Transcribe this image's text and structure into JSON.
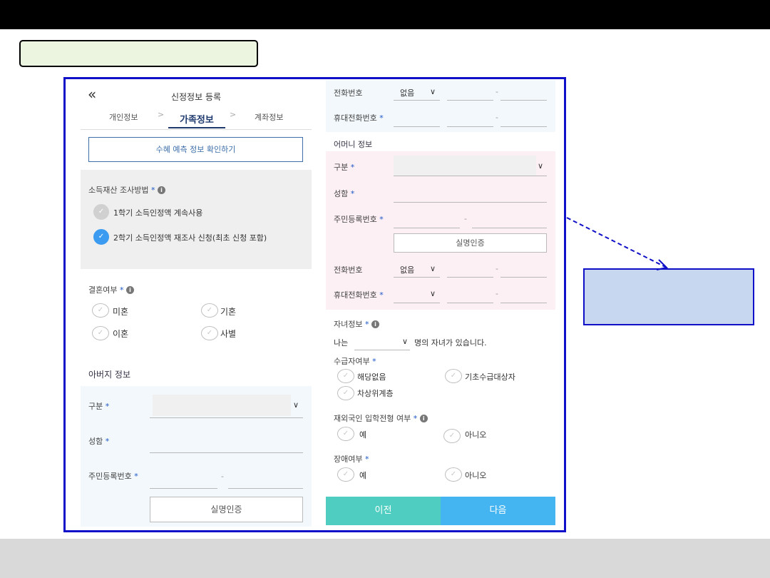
{
  "left_panel": {
    "back_icon": "double-chevron-left-icon",
    "title": "신정정보 등록",
    "steps": [
      "개인정보",
      "가족정보",
      "계좌정보"
    ],
    "check_button": "수혜 예측 정보 확인하기",
    "income_method_label": "소득재산 조사방법",
    "income_options": [
      "1학기 소득인정액 계속사용",
      "2학기 소득인정액 재조사 신청(최초 신청 포함)"
    ],
    "marriage_label": "결혼여부",
    "marriage_options": [
      "미혼",
      "기혼",
      "이혼",
      "사별"
    ],
    "father_section": "아버지 정보",
    "gubun_label": "구분",
    "name_label": "성함",
    "rrn_label": "주민등록번호",
    "rrn_dash": "-",
    "verify_button": "실명인증",
    "required_mark": "*"
  },
  "right_panel": {
    "phone_label": "전화번호",
    "phone_none": "없음",
    "mobile_label": "휴대전화번호",
    "dash": "-",
    "mother_section": "어머니 정보",
    "gubun_label": "구분",
    "name_label": "성함",
    "rrn_label": "주민등록번호",
    "verify_button": "실명인증",
    "children_label": "자녀정보",
    "children_prefix": "나는",
    "children_suffix": "명의 자녀가 있습니다.",
    "welfare_label": "수급자여부",
    "welfare_options": [
      "해당없음",
      "기초수급대상자",
      "차상위계층"
    ],
    "overseas_label": "재외국인 입학전형 여부",
    "yes": "예",
    "no": "아니오",
    "disability_label": "장애여부",
    "prev_button": "이전",
    "next_button": "다음",
    "required_mark": "*"
  },
  "colors": {
    "frame_border": "#1010c8",
    "active_step": "#1f3a6e",
    "prev_button": "#4ecdc0",
    "next_button": "#45b5f2",
    "mother_bg": "#fdf0f4",
    "father_bg": "#f3f8fc",
    "radio_checked": "#3b9bf0"
  }
}
